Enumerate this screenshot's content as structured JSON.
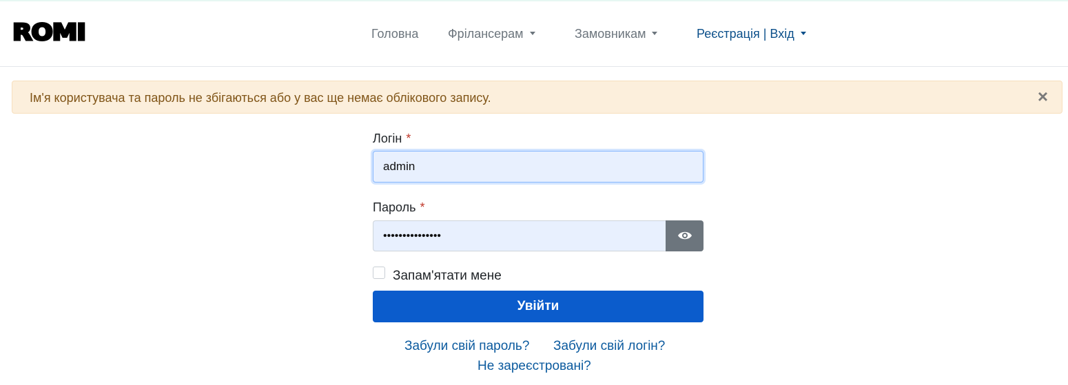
{
  "brand": {
    "logo_text": "ROMI"
  },
  "nav": {
    "items": [
      {
        "label": "Головна"
      },
      {
        "label": "Фрілансерам"
      },
      {
        "label": "Замовникам"
      }
    ],
    "auth_label": "Реєстрація | Вхід"
  },
  "alert": {
    "message": "Ім'я користувача та пароль не збігаються або у вас ще немає облікового запису.",
    "close_glyph": "×"
  },
  "form": {
    "login_label": "Логін",
    "login_value": "admin",
    "password_label": "Пароль",
    "password_value": "•••••••••••••••",
    "required_mark": "*",
    "remember_label": "Запам'ятати мене",
    "remember_checked": false,
    "submit_label": "Увійти",
    "show_password_icon": "eye-icon"
  },
  "links": {
    "forgot_password": "Забули свій пароль?",
    "forgot_login": "Забули свій логін?",
    "not_registered": "Не зареєстровані?"
  },
  "colors": {
    "primary": "#0b5ccc",
    "alert_bg": "#fcefdc",
    "alert_text": "#805518",
    "input_bg": "#e8f0fe",
    "nav_active": "#0b4f8a",
    "required": "#c0392b"
  }
}
